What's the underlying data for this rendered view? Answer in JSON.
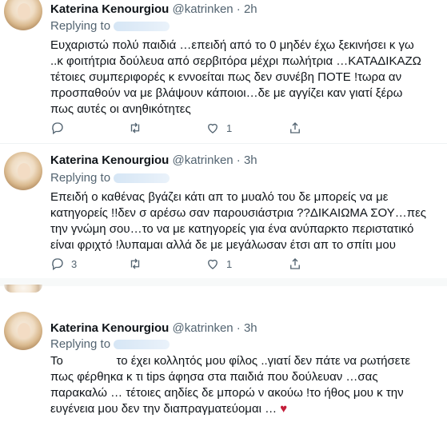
{
  "tweets": [
    {
      "author": "Katerina Kenourgiou",
      "handle": "@katrinken",
      "time": "2h",
      "replying": "Replying to",
      "text": "Ευχαριστώ πολύ παιδιά …επειδή από το 0 μηδέν έχω ξεκινήσει κ γω ..κ φοιτήτρια δούλευα από σερβιτόρα μέχρι πωλήτρια …ΚΑΤΑΔΙΚΑΖΩ τέτοιες συμπεριφορές κ εννοείται πως δεν συνέβη ΠΟΤΕ !τωρα αν προσπαθούν να με βλάψουν κάποιοι…δε με αγγίζει καν γιατί ξέρω πως αυτές οι ανηθικότητες",
      "replies": "",
      "retweets": "",
      "likes": "1"
    },
    {
      "author": "Katerina Kenourgiou",
      "handle": "@katrinken",
      "time": "3h",
      "replying": "Replying to",
      "text": "Επειδή ο καθένας βγάζει κάτι απ το μυαλό του δε μπορείς να με κατηγορείς !!δεν σ αρέσω σαν παρουσιάστρια ??ΔΙΚΑΙΩΜΑ ΣΟΥ…πες την γνώμη σου…το να με κατηγορείς για ένα ανύπαρκτο περιστατικό είναι φριχτό !λυπαμαι αλλά δε με μεγάλωσαν έτσι απ το σπίτι μου",
      "replies": "3",
      "retweets": "",
      "likes": "1"
    },
    {
      "author": "Katerina Kenourgiou",
      "handle": "@katrinken",
      "time": "3h",
      "replying": "Replying to",
      "text": "Το                το έχει κολλητός μου φίλος ..γιατί δεν πάτε να ρωτήσετε πως φέρθηκα κ τι tips άφησα στα παιδιά που δούλευαν …σας παρακαλώ … τέτοιες αηδίες δε μπορώ ν ακούω !το ήθος μου κ την ευγένεια μου δεν την διαπραγματεύομαι …",
      "heart": "♥",
      "replies": "",
      "retweets": "",
      "likes": ""
    }
  ],
  "sep": "·",
  "colors": {
    "muted": "#536471",
    "text": "#0f1419",
    "heart": "#c41e3a"
  }
}
